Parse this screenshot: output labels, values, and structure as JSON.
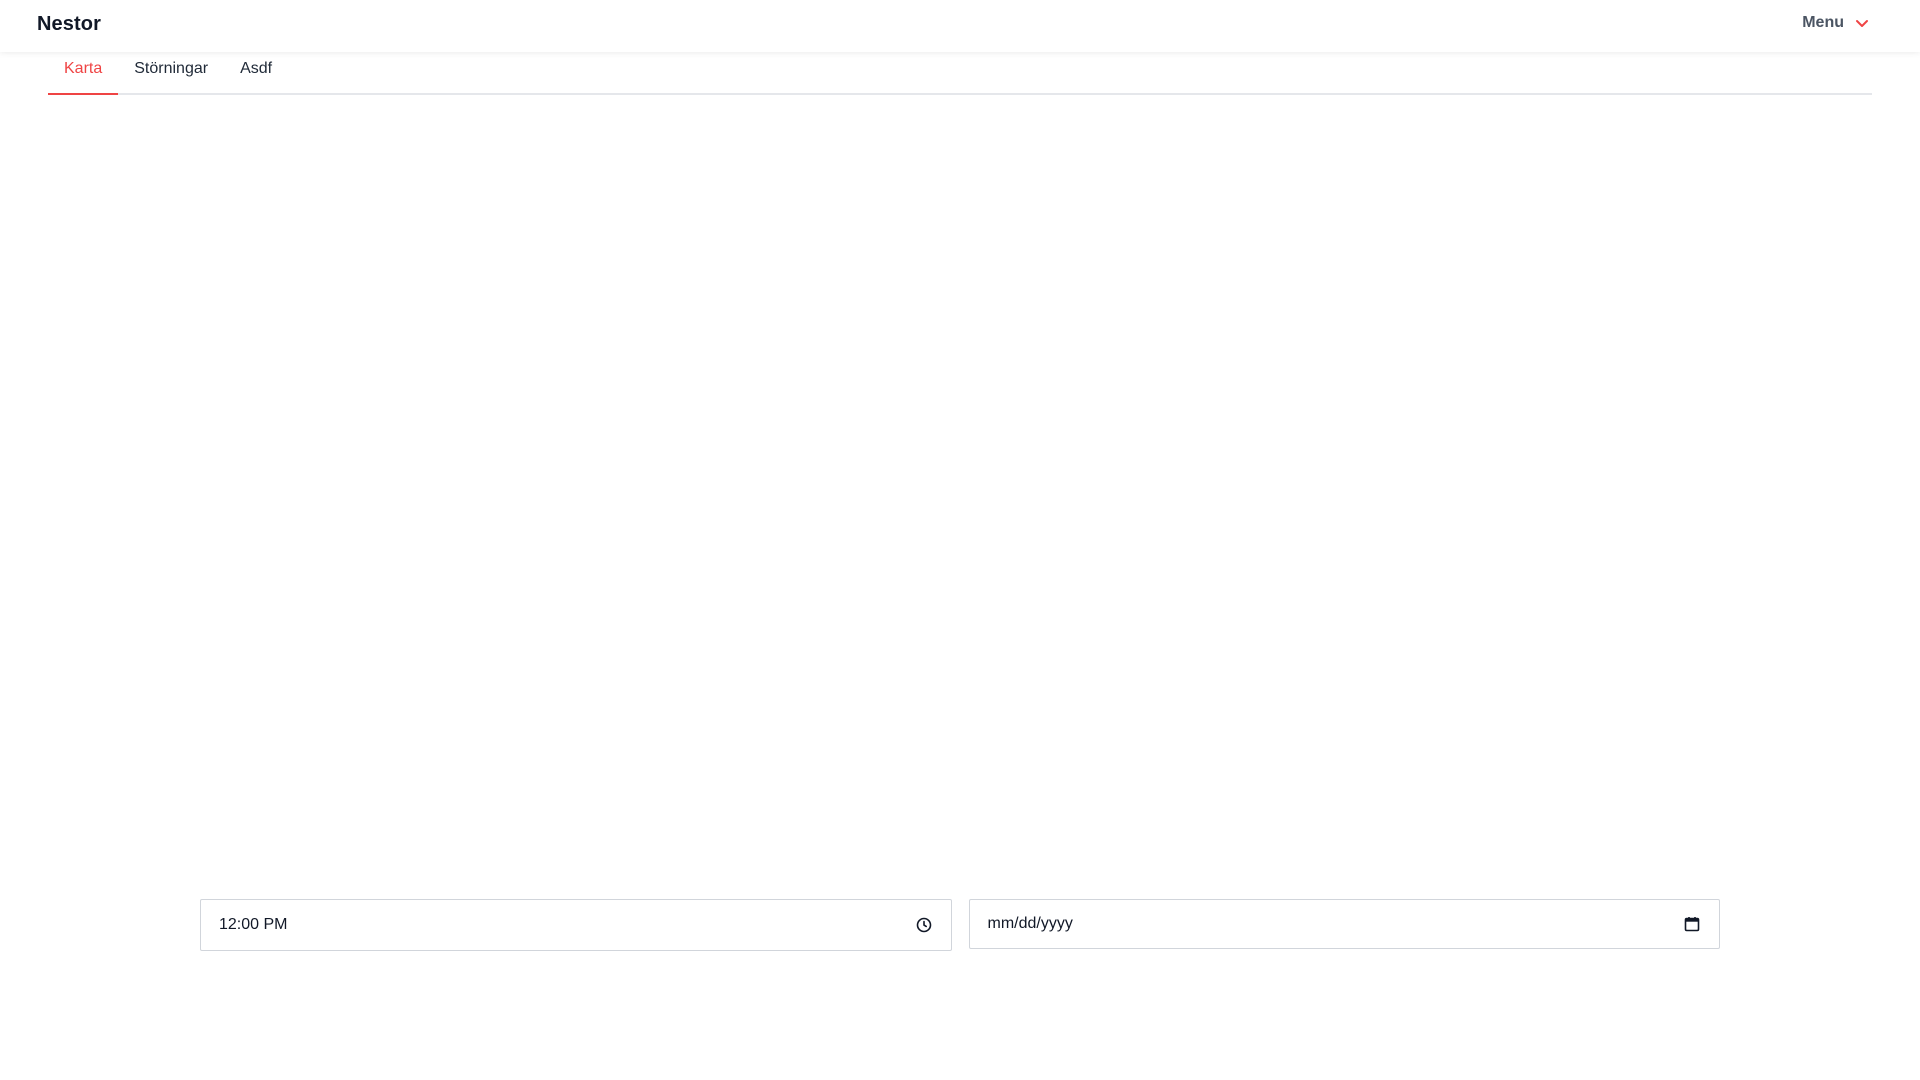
{
  "header": {
    "brand": "Nestor",
    "menu_label": "Menu",
    "accent_color": "#ef4444"
  },
  "tabs": [
    {
      "label": "Karta",
      "active": true
    },
    {
      "label": "Störningar",
      "active": false
    },
    {
      "label": "Asdf",
      "active": false
    }
  ],
  "controls": {
    "time_value": "12:00 PM",
    "time_icon": "clock-icon",
    "date_placeholder": "mm/dd/yyyy",
    "date_icon": "calendar-icon"
  }
}
